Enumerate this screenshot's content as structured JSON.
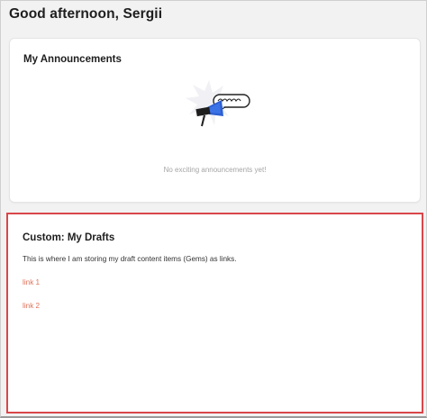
{
  "header": {
    "greeting": "Good afternoon, Sergii"
  },
  "announcements": {
    "title": "My Announcements",
    "illustration_icon": "megaphone-icon",
    "empty_text": "No exciting announcements yet!"
  },
  "drafts": {
    "title": "Custom: My Drafts",
    "description": "This is where I am storing my draft content items (Gems) as links.",
    "links": [
      "link 1",
      "link 2"
    ],
    "highlight_color": "#d9474a",
    "link_color": "#e07158"
  }
}
